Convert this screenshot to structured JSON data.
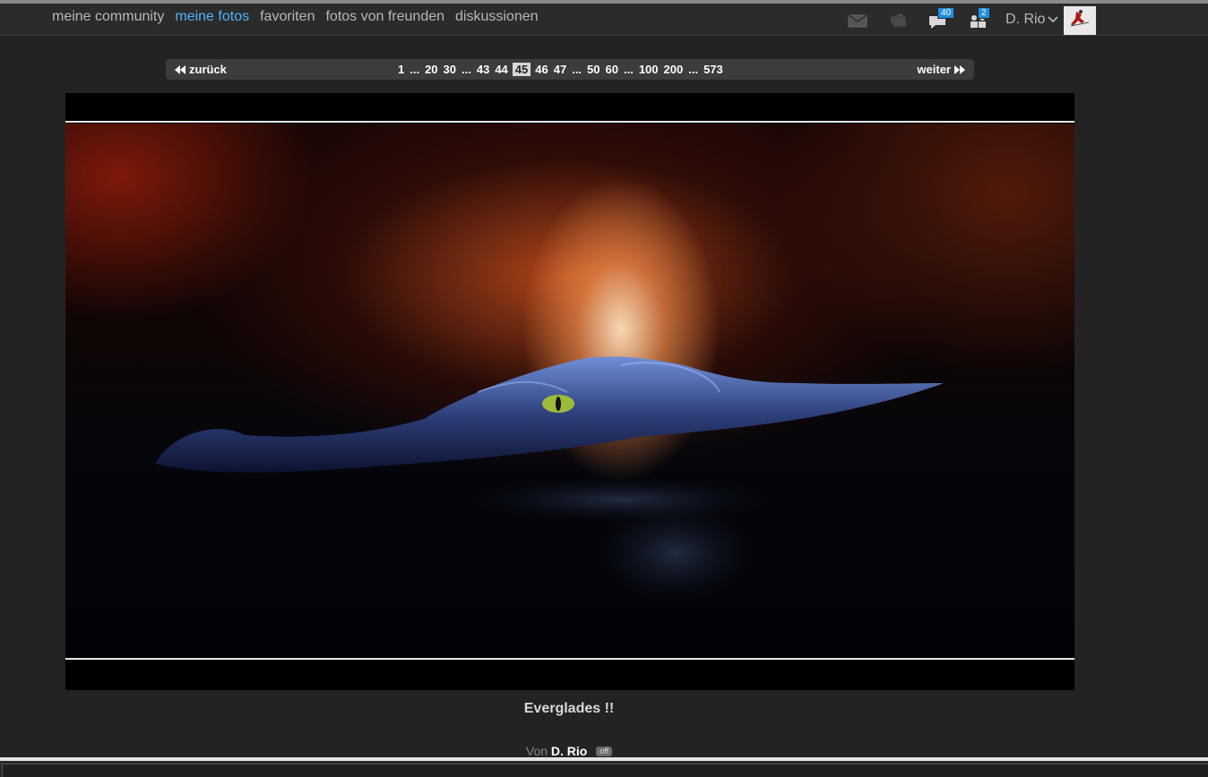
{
  "nav": {
    "items": [
      {
        "label": "meine community",
        "active": false
      },
      {
        "label": "meine fotos",
        "active": true
      },
      {
        "label": "favoriten",
        "active": false
      },
      {
        "label": "fotos von freunden",
        "active": false
      },
      {
        "label": "diskussionen",
        "active": false
      }
    ]
  },
  "toolbar": {
    "messages_icon": "envelope-icon",
    "cards_icon": "cards-icon",
    "comments_icon": "speech-bubble-icon",
    "comments_count": "40",
    "friends_icon": "people-icon",
    "friends_count": "2",
    "user_name": "D. Rio",
    "accent_color": "#4fb3ff",
    "badge_color": "#1f8fe0"
  },
  "pager": {
    "prev_label": "zurück",
    "next_label": "weiter",
    "pages": [
      "1",
      "...",
      "20",
      "30",
      "...",
      "43",
      "44",
      "45",
      "46",
      "47",
      "...",
      "50",
      "60",
      "...",
      "100",
      "200",
      "...",
      "573"
    ],
    "current": "45"
  },
  "photo": {
    "title": "Everglades !!",
    "by_prefix": "Von",
    "author": "D. Rio",
    "status": "off"
  }
}
